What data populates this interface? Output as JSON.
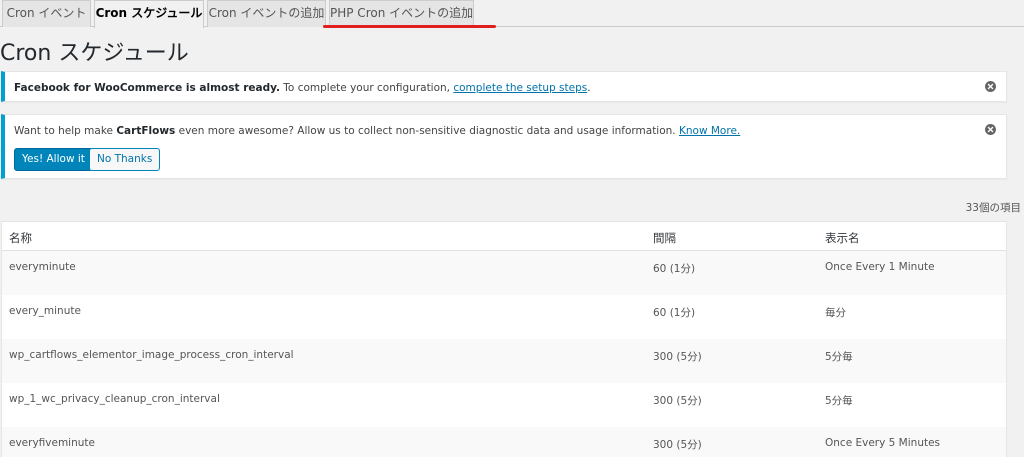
{
  "tabs": [
    {
      "label": "Cron イベント",
      "active": false
    },
    {
      "label": "Cron スケジュール",
      "active": true
    },
    {
      "label": "Cron イベントの追加",
      "active": false
    },
    {
      "label": "PHP Cron イベントの追加",
      "active": false
    }
  ],
  "page_title": "Cron スケジュール",
  "notice_facebook": {
    "bold": "Facebook for WooCommerce is almost ready.",
    "text": " To complete your configuration, ",
    "link": "complete the setup steps",
    "end": "."
  },
  "notice_cartflows": {
    "pre": "Want to help make ",
    "bold": "CartFlows",
    "post": " even more awesome? Allow us to collect non-sensitive diagnostic data and usage information. ",
    "link": "Know More.",
    "allow_button": "Yes! Allow it",
    "decline_button": "No Thanks"
  },
  "items_count": "33個の項目",
  "table": {
    "headers": [
      "名称",
      "間隔",
      "表示名"
    ],
    "rows": [
      [
        "everyminute",
        "60 (1分)",
        "Once Every 1 Minute"
      ],
      [
        "every_minute",
        "60 (1分)",
        "毎分"
      ],
      [
        "wp_cartflows_elementor_image_process_cron_interval",
        "300 (5分)",
        "5分毎"
      ],
      [
        "wp_1_wc_privacy_cleanup_cron_interval",
        "300 (5分)",
        "5分毎"
      ],
      [
        "everyfiveminute",
        "300 (5分)",
        "Once Every 5 Minutes"
      ]
    ]
  },
  "colors": {
    "notice_accent": "#00a0d2",
    "primary_button": "#0085ba",
    "highlight_underline": "#e02020"
  }
}
